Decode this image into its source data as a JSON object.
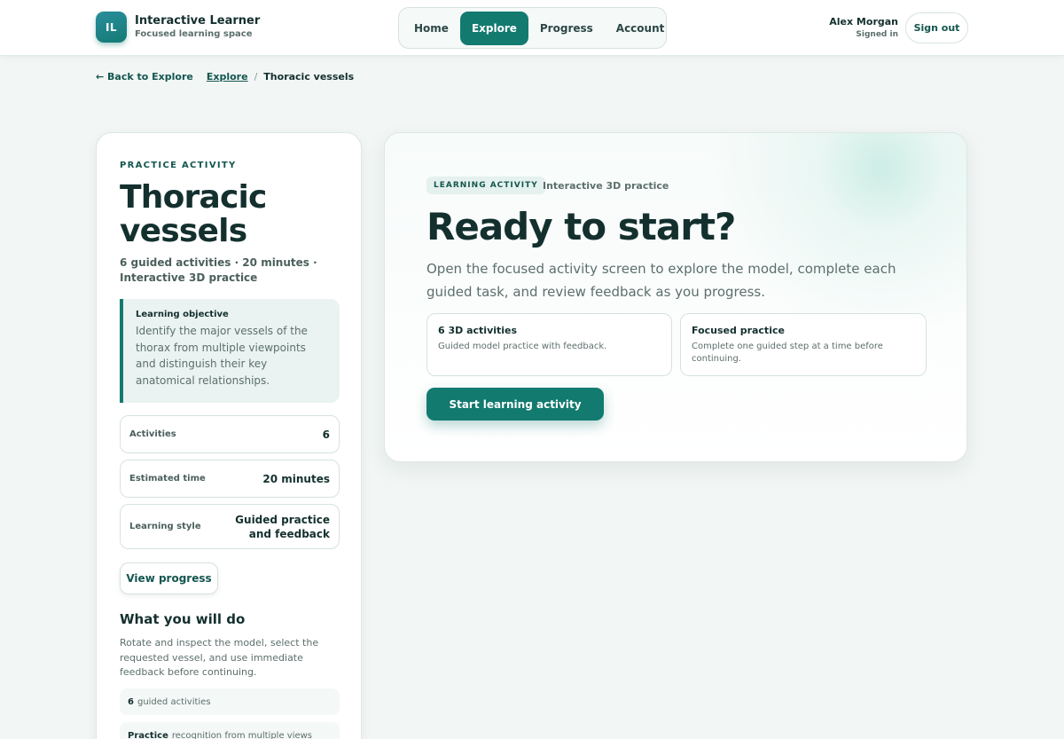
{
  "brand": {
    "logo": "IL",
    "title": "Interactive Learner",
    "subtitle": "Focused learning space"
  },
  "nav": {
    "items": [
      {
        "label": "Home",
        "active": false
      },
      {
        "label": "Explore",
        "active": true
      },
      {
        "label": "Progress",
        "active": false
      },
      {
        "label": "Account",
        "active": false
      }
    ]
  },
  "user": {
    "name": "Alex Morgan",
    "status": "Signed in",
    "signout_label": "Sign out"
  },
  "breadcrumb": {
    "back": "← Back to Explore",
    "link": "Explore",
    "separator": "/",
    "current": "Thoracic vessels"
  },
  "left": {
    "eyebrow": "PRACTICE ACTIVITY",
    "title": "Thoracic vessels",
    "meta": "6 guided activities · 20 minutes · Interactive 3D practice",
    "objective_label": "Learning objective",
    "objective_text": "Identify the major vessels of the thorax from multiple viewpoints and distinguish their key anatomical relationships.",
    "stats": [
      {
        "label": "Activities",
        "value": "6"
      },
      {
        "label": "Estimated time",
        "value": "20 minutes"
      },
      {
        "label": "Learning style",
        "value": "Guided practice and feedback"
      }
    ],
    "view_progress_label": "View progress",
    "what_title": "What you will do",
    "what_text": "Rotate and inspect the model, select the requested vessel, and use immediate feedback before continuing.",
    "items": [
      {
        "bold": "6",
        "text": "guided activities"
      },
      {
        "bold": "Practice",
        "text": "recognition from multiple views"
      }
    ]
  },
  "main": {
    "chip": "LEARNING ACTIVITY",
    "chip_sub": "Interactive 3D practice",
    "title": "Ready to start?",
    "description": "Open the focused activity screen to explore the model, complete each guided task, and review feedback as you progress.",
    "cards": [
      {
        "title": "6 3D activities",
        "text": "Guided model practice with feedback."
      },
      {
        "title": "Focused practice",
        "text": "Complete one guided step at a time before continuing."
      }
    ],
    "start_label": "Start learning activity"
  },
  "colors": {
    "accent": "#137a70",
    "text": "#13302e",
    "muted": "#5b6f6c",
    "background": "#f2f6f5"
  }
}
